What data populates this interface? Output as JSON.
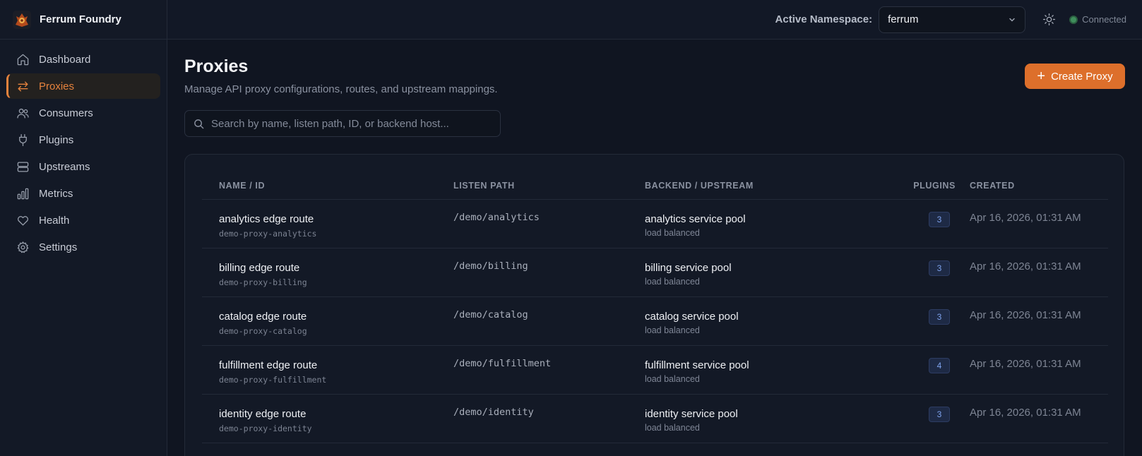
{
  "brand": {
    "name": "Ferrum Foundry"
  },
  "sidebar": {
    "items": [
      {
        "label": "Dashboard",
        "icon": "home-icon",
        "active": false
      },
      {
        "label": "Proxies",
        "icon": "swap-arrows-icon",
        "active": true
      },
      {
        "label": "Consumers",
        "icon": "users-icon",
        "active": false
      },
      {
        "label": "Plugins",
        "icon": "plug-icon",
        "active": false
      },
      {
        "label": "Upstreams",
        "icon": "server-icon",
        "active": false
      },
      {
        "label": "Metrics",
        "icon": "bar-chart-icon",
        "active": false
      },
      {
        "label": "Health",
        "icon": "heart-icon",
        "active": false
      },
      {
        "label": "Settings",
        "icon": "gear-icon",
        "active": false
      }
    ]
  },
  "topbar": {
    "namespace_label": "Active Namespace:",
    "namespace_value": "ferrum",
    "status": "Connected"
  },
  "page": {
    "title": "Proxies",
    "subtitle": "Manage API proxy configurations, routes, and upstream mappings.",
    "create_label": "Create Proxy"
  },
  "search": {
    "placeholder": "Search by name, listen path, ID, or backend host..."
  },
  "table": {
    "headers": [
      "NAME / ID",
      "LISTEN PATH",
      "BACKEND / UPSTREAM",
      "PLUGINS",
      "CREATED"
    ],
    "rows": [
      {
        "name": "analytics edge route",
        "id": "demo-proxy-analytics",
        "path": "/demo/analytics",
        "backend": "analytics service pool",
        "lb": "load balanced",
        "plugins": "3",
        "created": "Apr 16, 2026, 01:31 AM"
      },
      {
        "name": "billing edge route",
        "id": "demo-proxy-billing",
        "path": "/demo/billing",
        "backend": "billing service pool",
        "lb": "load balanced",
        "plugins": "3",
        "created": "Apr 16, 2026, 01:31 AM"
      },
      {
        "name": "catalog edge route",
        "id": "demo-proxy-catalog",
        "path": "/demo/catalog",
        "backend": "catalog service pool",
        "lb": "load balanced",
        "plugins": "3",
        "created": "Apr 16, 2026, 01:31 AM"
      },
      {
        "name": "fulfillment edge route",
        "id": "demo-proxy-fulfillment",
        "path": "/demo/fulfillment",
        "backend": "fulfillment service pool",
        "lb": "load balanced",
        "plugins": "4",
        "created": "Apr 16, 2026, 01:31 AM"
      },
      {
        "name": "identity edge route",
        "id": "demo-proxy-identity",
        "path": "/demo/identity",
        "backend": "identity service pool",
        "lb": "load balanced",
        "plugins": "3",
        "created": "Apr 16, 2026, 01:31 AM"
      }
    ]
  },
  "colors": {
    "accent": "#dd6f2b",
    "active_text": "#e5823d",
    "status_ok": "#3f8f5c",
    "badge_text": "#7ea2ec"
  }
}
